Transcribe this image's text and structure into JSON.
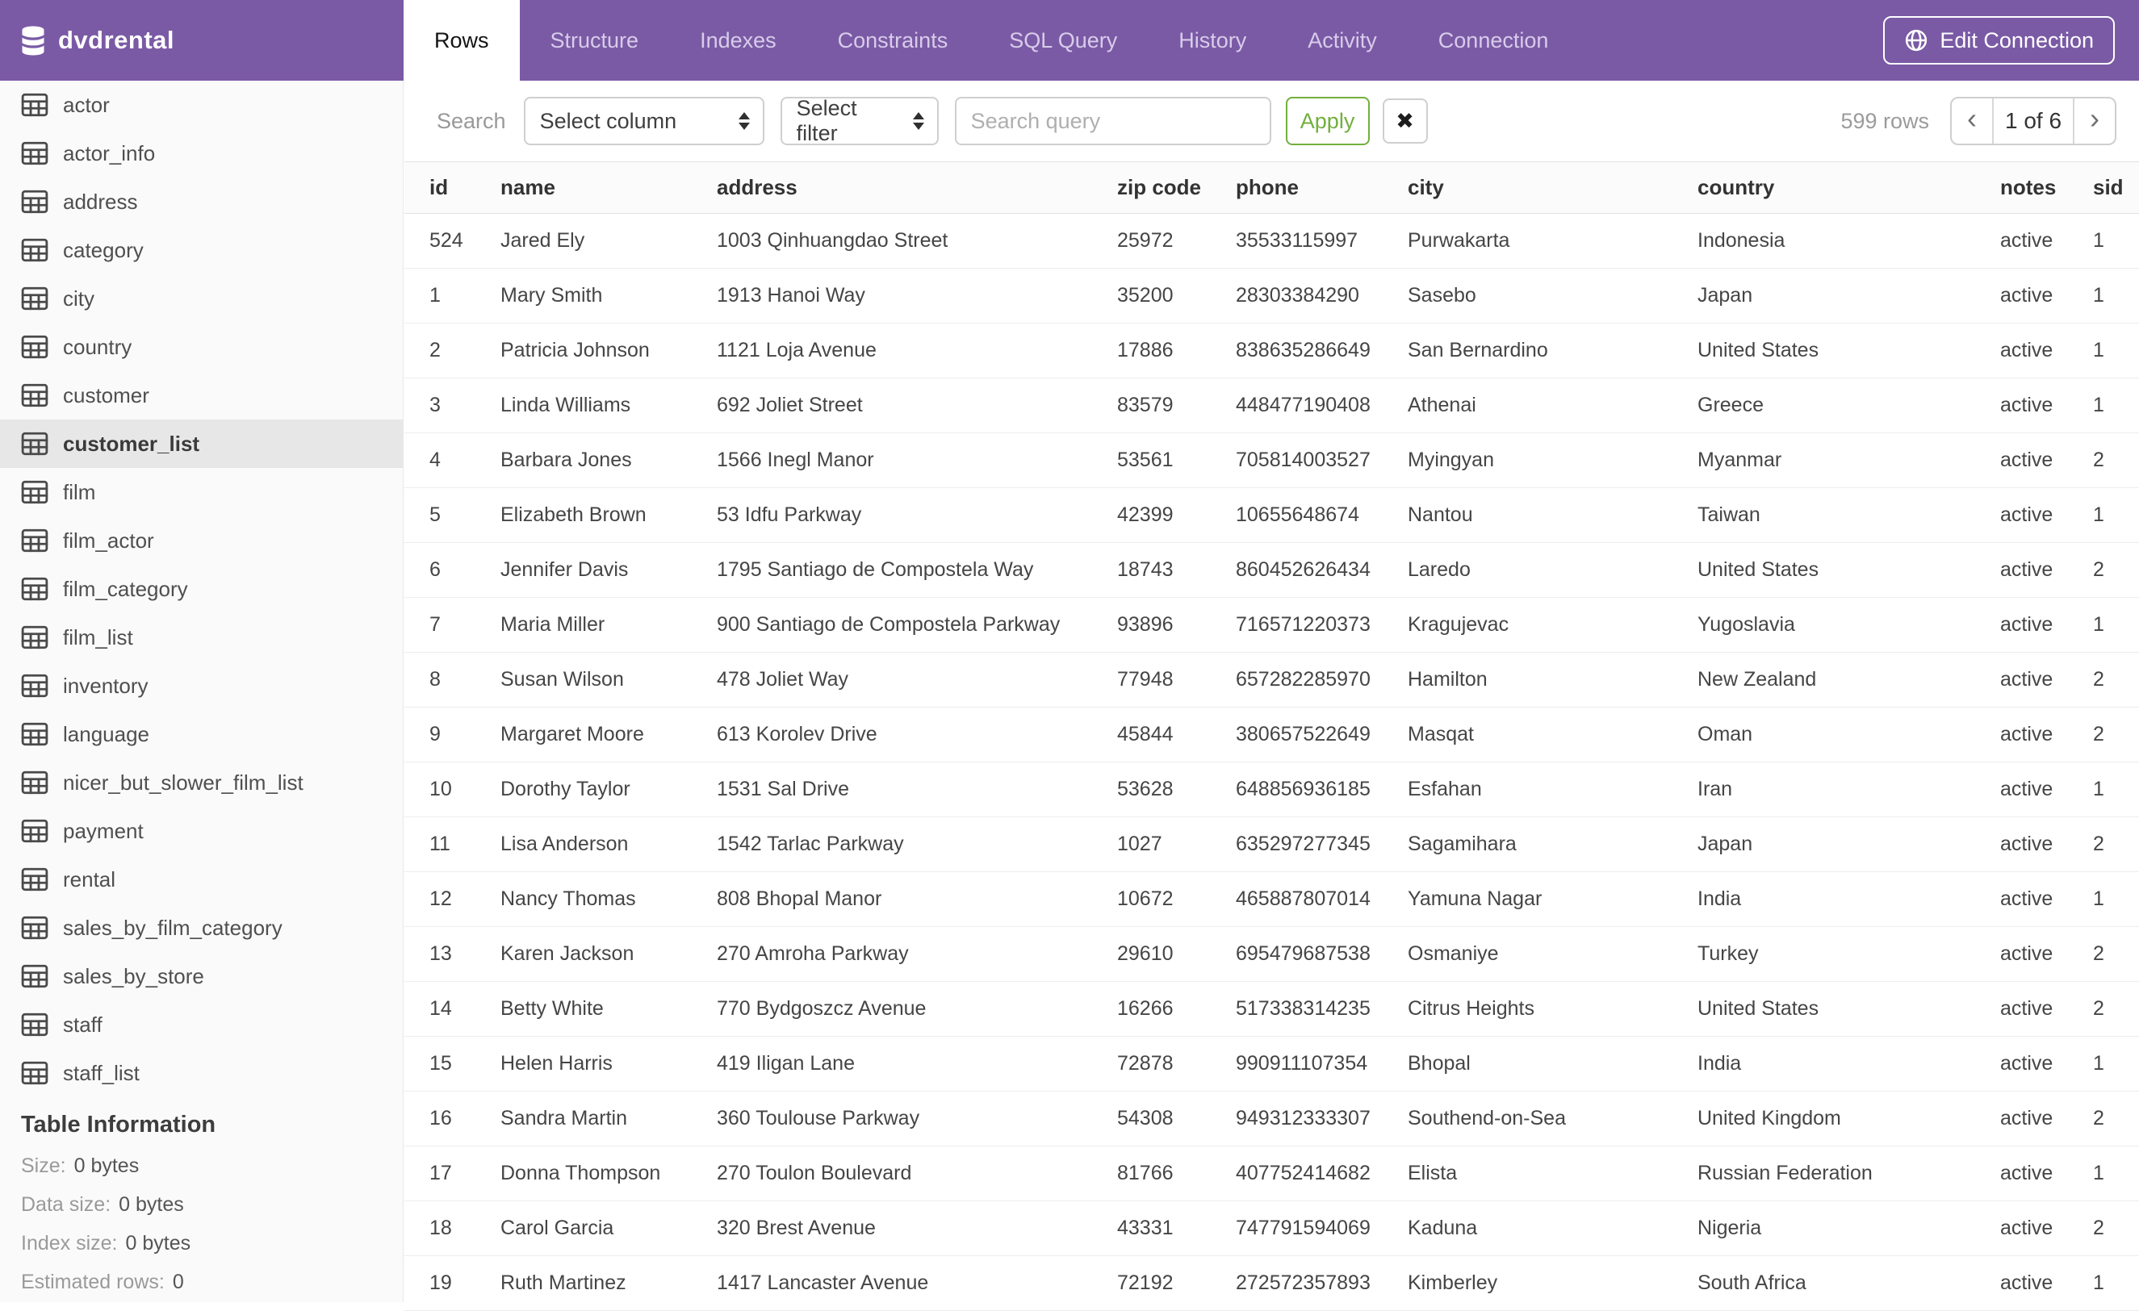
{
  "colors": {
    "brand_purple": "#7A5AA5",
    "accent_green": "#72AF3D"
  },
  "header": {
    "database_name": "dvdrental",
    "tabs": [
      {
        "label": "Rows",
        "active": true
      },
      {
        "label": "Structure",
        "active": false
      },
      {
        "label": "Indexes",
        "active": false
      },
      {
        "label": "Constraints",
        "active": false
      },
      {
        "label": "SQL Query",
        "active": false
      },
      {
        "label": "History",
        "active": false
      },
      {
        "label": "Activity",
        "active": false
      },
      {
        "label": "Connection",
        "active": false
      }
    ],
    "edit_connection_label": "Edit Connection"
  },
  "sidebar": {
    "tables": [
      "actor",
      "actor_info",
      "address",
      "category",
      "city",
      "country",
      "customer",
      "customer_list",
      "film",
      "film_actor",
      "film_category",
      "film_list",
      "inventory",
      "language",
      "nicer_but_slower_film_list",
      "payment",
      "rental",
      "sales_by_film_category",
      "sales_by_store",
      "staff",
      "staff_list"
    ],
    "selected_table": "customer_list",
    "table_information": {
      "heading": "Table Information",
      "rows": [
        {
          "label": "Size:",
          "value": "0 bytes"
        },
        {
          "label": "Data size:",
          "value": "0 bytes"
        },
        {
          "label": "Index size:",
          "value": "0 bytes"
        },
        {
          "label": "Estimated rows:",
          "value": "0"
        }
      ]
    }
  },
  "toolbar": {
    "search_label": "Search",
    "select_column_value": "Select column",
    "select_filter_value": "Select filter",
    "search_placeholder": "Search query",
    "apply_label": "Apply",
    "clear_label": "✖",
    "row_count": "599 rows",
    "pagination": {
      "prev": "‹",
      "current": "1 of 6",
      "next": "›"
    }
  },
  "table": {
    "columns": [
      "id",
      "name",
      "address",
      "zip code",
      "phone",
      "city",
      "country",
      "notes",
      "sid"
    ],
    "rows": [
      [
        "524",
        "Jared Ely",
        "1003 Qinhuangdao Street",
        "25972",
        "35533115997",
        "Purwakarta",
        "Indonesia",
        "active",
        "1"
      ],
      [
        "1",
        "Mary Smith",
        "1913 Hanoi Way",
        "35200",
        "28303384290",
        "Sasebo",
        "Japan",
        "active",
        "1"
      ],
      [
        "2",
        "Patricia Johnson",
        "1121 Loja Avenue",
        "17886",
        "838635286649",
        "San Bernardino",
        "United States",
        "active",
        "1"
      ],
      [
        "3",
        "Linda Williams",
        "692 Joliet Street",
        "83579",
        "448477190408",
        "Athenai",
        "Greece",
        "active",
        "1"
      ],
      [
        "4",
        "Barbara Jones",
        "1566 Inegl Manor",
        "53561",
        "705814003527",
        "Myingyan",
        "Myanmar",
        "active",
        "2"
      ],
      [
        "5",
        "Elizabeth Brown",
        "53 Idfu Parkway",
        "42399",
        "10655648674",
        "Nantou",
        "Taiwan",
        "active",
        "1"
      ],
      [
        "6",
        "Jennifer Davis",
        "1795 Santiago de Compostela Way",
        "18743",
        "860452626434",
        "Laredo",
        "United States",
        "active",
        "2"
      ],
      [
        "7",
        "Maria Miller",
        "900 Santiago de Compostela Parkway",
        "93896",
        "716571220373",
        "Kragujevac",
        "Yugoslavia",
        "active",
        "1"
      ],
      [
        "8",
        "Susan Wilson",
        "478 Joliet Way",
        "77948",
        "657282285970",
        "Hamilton",
        "New Zealand",
        "active",
        "2"
      ],
      [
        "9",
        "Margaret Moore",
        "613 Korolev Drive",
        "45844",
        "380657522649",
        "Masqat",
        "Oman",
        "active",
        "2"
      ],
      [
        "10",
        "Dorothy Taylor",
        "1531 Sal Drive",
        "53628",
        "648856936185",
        "Esfahan",
        "Iran",
        "active",
        "1"
      ],
      [
        "11",
        "Lisa Anderson",
        "1542 Tarlac Parkway",
        "1027",
        "635297277345",
        "Sagamihara",
        "Japan",
        "active",
        "2"
      ],
      [
        "12",
        "Nancy Thomas",
        "808 Bhopal Manor",
        "10672",
        "465887807014",
        "Yamuna Nagar",
        "India",
        "active",
        "1"
      ],
      [
        "13",
        "Karen Jackson",
        "270 Amroha Parkway",
        "29610",
        "695479687538",
        "Osmaniye",
        "Turkey",
        "active",
        "2"
      ],
      [
        "14",
        "Betty White",
        "770 Bydgoszcz Avenue",
        "16266",
        "517338314235",
        "Citrus Heights",
        "United States",
        "active",
        "2"
      ],
      [
        "15",
        "Helen Harris",
        "419 Iligan Lane",
        "72878",
        "990911107354",
        "Bhopal",
        "India",
        "active",
        "1"
      ],
      [
        "16",
        "Sandra Martin",
        "360 Toulouse Parkway",
        "54308",
        "949312333307",
        "Southend-on-Sea",
        "United Kingdom",
        "active",
        "2"
      ],
      [
        "17",
        "Donna Thompson",
        "270 Toulon Boulevard",
        "81766",
        "407752414682",
        "Elista",
        "Russian Federation",
        "active",
        "1"
      ],
      [
        "18",
        "Carol Garcia",
        "320 Brest Avenue",
        "43331",
        "747791594069",
        "Kaduna",
        "Nigeria",
        "active",
        "2"
      ],
      [
        "19",
        "Ruth Martinez",
        "1417 Lancaster Avenue",
        "72192",
        "272572357893",
        "Kimberley",
        "South Africa",
        "active",
        "1"
      ]
    ]
  }
}
